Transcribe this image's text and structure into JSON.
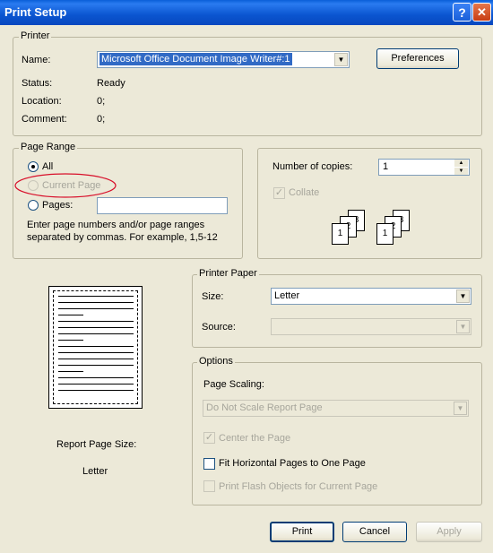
{
  "window": {
    "title": "Print Setup",
    "help_glyph": "?",
    "close_glyph": "✕"
  },
  "printer": {
    "legend": "Printer",
    "name_label": "Name:",
    "name_value": "Microsoft Office Document Image Writer#:1",
    "preferences_label": "Preferences",
    "status_label": "Status:",
    "status_value": "Ready",
    "location_label": "Location:",
    "location_value": "0;",
    "comment_label": "Comment:",
    "comment_value": "0;"
  },
  "page_range": {
    "legend": "Page Range",
    "all_label": "All",
    "current_page_label": "Current Page",
    "pages_label": "Pages:",
    "pages_value": "",
    "hint_line1": "Enter page numbers and/or page ranges",
    "hint_line2": "separated by commas. For example, 1,5-12"
  },
  "copies": {
    "label": "Number of copies:",
    "value": "1",
    "collate_label": "Collate",
    "collate_glyph": "✓",
    "page_numbers": [
      "1",
      "2",
      "3"
    ]
  },
  "preview": {
    "size_label": "Report Page Size:",
    "size_value": "Letter"
  },
  "printer_paper": {
    "legend": "Printer Paper",
    "size_label": "Size:",
    "size_value": "Letter",
    "source_label": "Source:",
    "source_value": ""
  },
  "options": {
    "legend": "Options",
    "scaling_label": "Page Scaling:",
    "scaling_value": "Do Not Scale Report Page",
    "center_label": "Center the Page",
    "center_glyph": "✓",
    "fit_label": "Fit Horizontal Pages to One Page",
    "flash_label": "Print Flash Objects for Current Page"
  },
  "footer": {
    "print_label": "Print",
    "cancel_label": "Cancel",
    "apply_label": "Apply"
  },
  "icons": {
    "dropdown_arrow": "▼",
    "spin_up": "▲",
    "spin_down": "▼"
  },
  "colors": {
    "annotation_circle": "#d8102b",
    "title_bar": "#0a55d0",
    "dialog_bg": "#ece9d8"
  }
}
